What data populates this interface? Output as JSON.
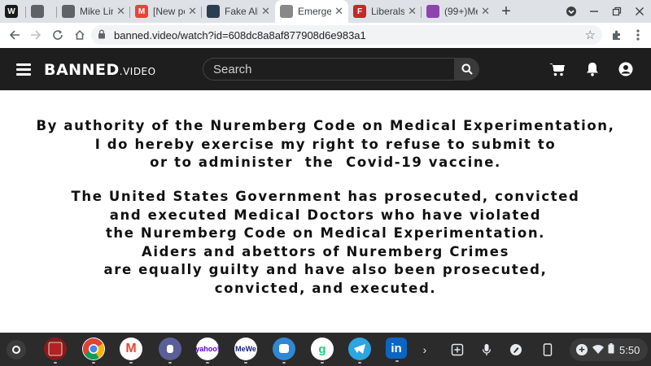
{
  "browser": {
    "tabs": [
      {
        "title": "",
        "favicon": "w-logo-icon",
        "favicon_text": "W",
        "color": "#1a1a1a"
      },
      {
        "title": "",
        "favicon": "globe-icon",
        "favicon_text": "",
        "color": "#5f6368"
      },
      {
        "title": "Mike Lin",
        "favicon": "globe-icon",
        "favicon_text": "",
        "color": "#5f6368"
      },
      {
        "title": "[New po",
        "favicon": "gmail-icon",
        "favicon_text": "M",
        "color": "#ea4335"
      },
      {
        "title": "Fake Ali",
        "favicon": "video-thumbnail-icon",
        "favicon_text": "",
        "color": "#2c3e50"
      },
      {
        "title": "Emerger",
        "favicon": "dots-icon",
        "favicon_text": "",
        "color": "#888888",
        "active": true
      },
      {
        "title": "Liberals",
        "favicon": "f-logo-icon",
        "favicon_text": "F",
        "color": "#c62828"
      },
      {
        "title": "(99+)Me",
        "favicon": "dots-color-icon",
        "favicon_text": "",
        "color": "#8e44ad"
      }
    ],
    "new_tab_label": "+",
    "url": "banned.video/watch?id=608dc8a8af877908d6e983a1"
  },
  "site": {
    "logo_main": "BANNED",
    "logo_suffix": ".VIDEO",
    "search_placeholder": "Search"
  },
  "content": {
    "paragraph1": [
      "By authority of the Nuremberg Code on Medical Experimentation,",
      "I do hereby exercise my right to refuse to submit to",
      "or to administer  the  Covid-19 vaccine."
    ],
    "paragraph2": [
      "The United States Government has prosecuted, convicted",
      "and executed Medical Doctors who have violated",
      "the Nuremberg Code on Medical Experimentation.",
      "Aiders and abettors of Nuremberg Crimes",
      "are equally guilty and have also been prosecuted,",
      "convicted, and executed."
    ]
  },
  "shelf": {
    "apps": [
      {
        "name": "shelf-app-book",
        "label": "",
        "color": "#8b1a1a"
      },
      {
        "name": "shelf-app-chrome",
        "label": "",
        "color": "#ffffff"
      },
      {
        "name": "shelf-app-gmail",
        "label": "M",
        "color": "#ffffff"
      },
      {
        "name": "shelf-app-signal",
        "label": "",
        "color": "#5b5f97"
      },
      {
        "name": "shelf-app-yahoo",
        "label": "yahoo!",
        "color": "#ffffff"
      },
      {
        "name": "shelf-app-mewe",
        "label": "MeWe",
        "color": "#ffffff"
      },
      {
        "name": "shelf-app-mastodon",
        "label": "",
        "color": "#3088d4"
      },
      {
        "name": "shelf-app-gab",
        "label": "g",
        "color": "#ffffff"
      },
      {
        "name": "shelf-app-telegram",
        "label": "",
        "color": "#2ca5e0"
      },
      {
        "name": "shelf-app-linkedin",
        "label": "in",
        "color": "#0a66c2"
      }
    ],
    "time": "5:50"
  }
}
